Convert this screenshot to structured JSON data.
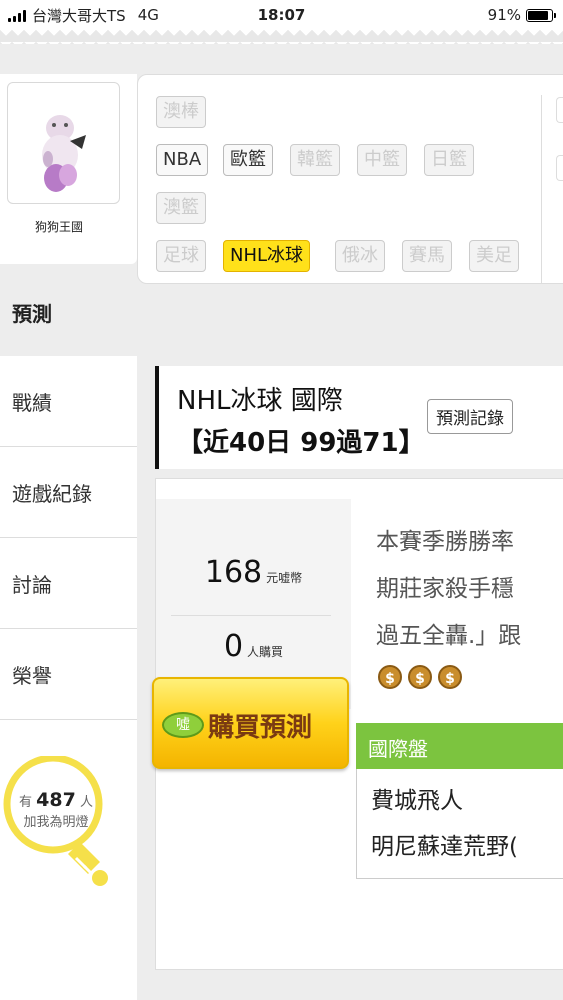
{
  "status_bar": {
    "carrier": "台灣大哥大TS",
    "network": "4G",
    "time": "18:07",
    "battery": "91%"
  },
  "profile": {
    "name": "狗狗王國",
    "avatar_icon": "dog-figurine-avatar"
  },
  "sports": {
    "row1": [
      {
        "label": "澳棒",
        "state": "disabled"
      }
    ],
    "row2": [
      {
        "label": "NBA",
        "state": "normal"
      },
      {
        "label": "歐籃",
        "state": "normal"
      },
      {
        "label": "韓籃",
        "state": "disabled"
      },
      {
        "label": "中籃",
        "state": "disabled"
      },
      {
        "label": "日籃",
        "state": "disabled"
      }
    ],
    "row3": [
      {
        "label": "澳籃",
        "state": "disabled"
      }
    ],
    "row4": [
      {
        "label": "足球",
        "state": "disabled"
      },
      {
        "label": "NHL冰球",
        "state": "active"
      },
      {
        "label": "俄冰",
        "state": "disabled"
      },
      {
        "label": "賽馬",
        "state": "disabled"
      },
      {
        "label": "美足",
        "state": "disabled"
      }
    ]
  },
  "nav": {
    "active": "預測",
    "items": [
      "戰績",
      "遊戲紀錄",
      "討論",
      "榮譽"
    ]
  },
  "fans": {
    "prefix": "有",
    "count": "487",
    "suffix": "人",
    "cta": "加我為明燈",
    "icon": "lightbulb-icon"
  },
  "prediction": {
    "title": "NHL冰球 國際",
    "record": "【近40日 99過71】",
    "record_button": "預測記錄",
    "price_value": "168",
    "price_unit": "元嘘幣",
    "buyers_value": "0",
    "buyers_unit": "人購買",
    "description_lines": [
      "本賽季勝勝率",
      "期莊家殺手穩",
      "過五全轟.」跟"
    ],
    "moneybag_count": 3,
    "buy_label": "購買預測",
    "buy_icon_text": "噓",
    "market_label": "國際盤",
    "teams": [
      "費城飛人",
      "明尼蘇達荒野("
    ]
  },
  "colors": {
    "active_tag": "#ffe11a",
    "market_bar": "#7cc43f",
    "buy_button": "#ffd21a",
    "buy_text": "#7a3a12",
    "lightbulb": "#f5e04a"
  }
}
